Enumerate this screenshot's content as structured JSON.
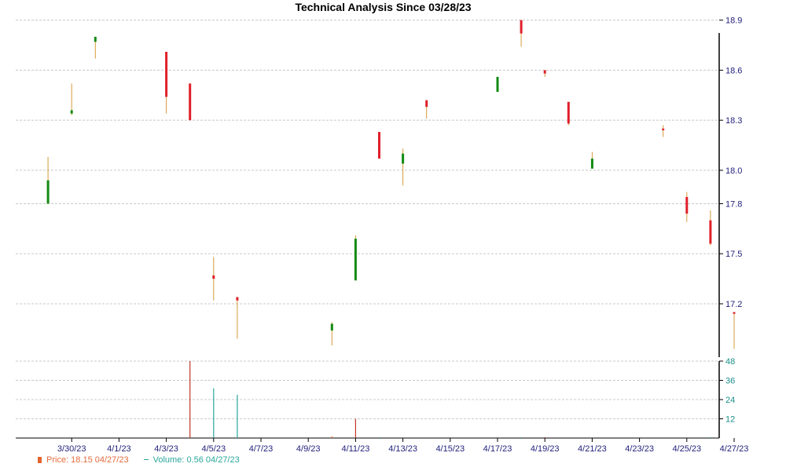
{
  "chart_data": [
    {
      "type": "candlestick",
      "title": "Technical Analysis Since 03/28/23",
      "x_ticks": [
        "3/30/23",
        "4/1/23",
        "4/3/23",
        "4/5/23",
        "4/7/23",
        "4/9/23",
        "4/11/23",
        "4/13/23",
        "4/15/23",
        "4/17/23",
        "4/19/23",
        "4/21/23",
        "4/23/23",
        "4/25/23",
        "4/27/23"
      ],
      "y_ticks": [
        17.2,
        17.5,
        17.8,
        18.0,
        18.3,
        18.6,
        18.9
      ],
      "y_tick_labels": [
        "17.2",
        "17.5",
        "17.8",
        "18.0",
        "18.3",
        "18.6",
        "18.9"
      ],
      "ylim": [
        16.88,
        18.95
      ],
      "grid": true,
      "y_axis_side": "right",
      "candles": [
        {
          "date": "3/29/23",
          "open": 17.8,
          "high": 18.08,
          "low": 17.8,
          "close": 17.94
        },
        {
          "date": "3/30/23",
          "open": 18.34,
          "high": 18.52,
          "low": 18.33,
          "close": 18.36
        },
        {
          "date": "3/31/23",
          "open": 18.77,
          "high": 18.8,
          "low": 18.67,
          "close": 18.8
        },
        {
          "date": "4/3/23",
          "open": 18.71,
          "high": 18.71,
          "low": 18.34,
          "close": 18.44
        },
        {
          "date": "4/4/23",
          "open": 18.52,
          "high": 18.52,
          "low": 18.3,
          "close": 18.3
        },
        {
          "date": "4/5/23",
          "open": 17.37,
          "high": 17.48,
          "low": 17.22,
          "close": 17.35
        },
        {
          "date": "4/6/23",
          "open": 17.24,
          "high": 17.24,
          "low": 16.99,
          "close": 17.22
        },
        {
          "date": "4/10/23",
          "open": 17.04,
          "high": 17.09,
          "low": 16.95,
          "close": 17.08
        },
        {
          "date": "4/11/23",
          "open": 17.34,
          "high": 17.61,
          "low": 17.34,
          "close": 17.59
        },
        {
          "date": "4/12/23",
          "open": 18.23,
          "high": 18.23,
          "low": 18.07,
          "close": 18.07
        },
        {
          "date": "4/13/23",
          "open": 18.04,
          "high": 18.13,
          "low": 17.91,
          "close": 18.1
        },
        {
          "date": "4/14/23",
          "open": 18.42,
          "high": 18.42,
          "low": 18.31,
          "close": 18.38
        },
        {
          "date": "4/17/23",
          "open": 18.47,
          "high": 18.56,
          "low": 18.47,
          "close": 18.56
        },
        {
          "date": "4/18/23",
          "open": 18.9,
          "high": 18.9,
          "low": 18.74,
          "close": 18.82
        },
        {
          "date": "4/19/23",
          "open": 18.6,
          "high": 18.6,
          "low": 18.56,
          "close": 18.58
        },
        {
          "date": "4/20/23",
          "open": 18.41,
          "high": 18.41,
          "low": 18.27,
          "close": 18.28
        },
        {
          "date": "4/21/23",
          "open": 18.01,
          "high": 18.11,
          "low": 18.01,
          "close": 18.07
        },
        {
          "date": "4/24/23",
          "open": 18.25,
          "high": 18.27,
          "low": 18.2,
          "close": 18.24
        },
        {
          "date": "4/25/23",
          "open": 17.84,
          "high": 17.87,
          "low": 17.69,
          "close": 17.74
        },
        {
          "date": "4/26/23",
          "open": 17.7,
          "high": 17.76,
          "low": 17.55,
          "close": 17.56
        },
        {
          "date": "4/27/23",
          "open": 17.15,
          "high": 17.15,
          "low": 16.93,
          "close": 17.14
        }
      ]
    },
    {
      "type": "bar",
      "y_ticks": [
        12,
        24,
        36,
        48
      ],
      "y_tick_labels": [
        "12",
        "24",
        "36",
        "48"
      ],
      "ylim": [
        0,
        48
      ],
      "grid": true,
      "y_axis_side": "right",
      "bars": [
        {
          "date": "4/4/23",
          "value": 48,
          "color": "#c0392b"
        },
        {
          "date": "4/5/23",
          "value": 31,
          "color": "#2aa79b"
        },
        {
          "date": "4/6/23",
          "value": 27,
          "color": "#2aa79b"
        },
        {
          "date": "4/10/23",
          "value": 1,
          "color": "#e3652f"
        },
        {
          "date": "4/11/23",
          "value": 12,
          "color": "#c0392b"
        },
        {
          "date": "4/12/23",
          "value": 0.5,
          "color": "#2aa79b"
        },
        {
          "date": "4/18/23",
          "value": 0.5,
          "color": "#2aa79b"
        },
        {
          "date": "4/19/23",
          "value": 0.5,
          "color": "#c0392b"
        },
        {
          "date": "4/26/23",
          "value": 0.56,
          "color": "#2aa79b"
        }
      ]
    }
  ],
  "legend": {
    "price_label": "Price: 18.15  04/27/23",
    "volume_label": "Volume: 0.56  04/27/23"
  },
  "colors": {
    "up": "#138b13",
    "down": "#e0202a",
    "wick": "#d59a3a",
    "grid": "#c8c8c8",
    "axis": "#000000",
    "price_tick_text": "#1f1f7a",
    "volume_tick_text": "#1a8f8a"
  }
}
